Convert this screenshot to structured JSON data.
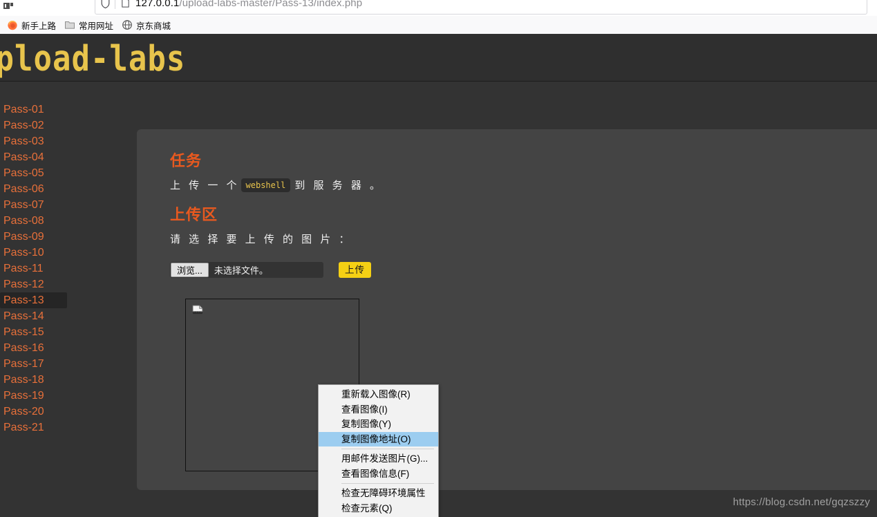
{
  "browser": {
    "url_host": "127.0.0.1",
    "url_path": "/upload-labs-master/Pass-13/index.php",
    "shield_icon": "shield-icon",
    "page_icon": "page-icon",
    "bookmarks": [
      {
        "label": "新手上路",
        "icon": "firefox-icon"
      },
      {
        "label": "常用网址",
        "icon": "folder-icon"
      },
      {
        "label": "京东商城",
        "icon": "globe-icon"
      }
    ]
  },
  "site": {
    "logo_text": "upload-labs",
    "logo_color": "#e8c44c"
  },
  "sidebar": {
    "items": [
      {
        "label": "Pass-01",
        "active": false
      },
      {
        "label": "Pass-02",
        "active": false
      },
      {
        "label": "Pass-03",
        "active": false
      },
      {
        "label": "Pass-04",
        "active": false
      },
      {
        "label": "Pass-05",
        "active": false
      },
      {
        "label": "Pass-06",
        "active": false
      },
      {
        "label": "Pass-07",
        "active": false
      },
      {
        "label": "Pass-08",
        "active": false
      },
      {
        "label": "Pass-09",
        "active": false
      },
      {
        "label": "Pass-10",
        "active": false
      },
      {
        "label": "Pass-11",
        "active": false
      },
      {
        "label": "Pass-12",
        "active": false
      },
      {
        "label": "Pass-13",
        "active": true
      },
      {
        "label": "Pass-14",
        "active": false
      },
      {
        "label": "Pass-15",
        "active": false
      },
      {
        "label": "Pass-16",
        "active": false
      },
      {
        "label": "Pass-17",
        "active": false
      },
      {
        "label": "Pass-18",
        "active": false
      },
      {
        "label": "Pass-19",
        "active": false
      },
      {
        "label": "Pass-20",
        "active": false
      },
      {
        "label": "Pass-21",
        "active": false
      }
    ],
    "link_color": "#e8703a",
    "active_bg": "#252525"
  },
  "main": {
    "task_heading": "任务",
    "task_text_before": "上 传 一 个",
    "task_code": "webshell",
    "task_text_after": "到 服 务 器 。",
    "upload_heading": "上传区",
    "upload_prompt": "请 选 择 要 上 传 的 图 片 ：",
    "browse_button": "浏览...",
    "file_status": "未选择文件。",
    "submit_button": "上传",
    "heading_color": "#e8591f",
    "submit_color": "#f5d014",
    "broken_image_icon": "broken-image-icon"
  },
  "context_menu": {
    "items": [
      {
        "label": "重新载入图像(R)",
        "accel": "R",
        "highlighted": false,
        "separator_after": false
      },
      {
        "label": "查看图像(I)",
        "accel": "I",
        "highlighted": false,
        "separator_after": false
      },
      {
        "label": "复制图像(Y)",
        "accel": "Y",
        "highlighted": false,
        "separator_after": false
      },
      {
        "label": "复制图像地址(O)",
        "accel": "O",
        "highlighted": true,
        "separator_after": true
      },
      {
        "label": "用邮件发送图片(G)...",
        "accel": "G",
        "highlighted": false,
        "separator_after": false
      },
      {
        "label": "查看图像信息(F)",
        "accel": "F",
        "highlighted": false,
        "separator_after": true
      },
      {
        "label": "检查无障碍环境属性",
        "accel": "",
        "highlighted": false,
        "separator_after": false
      },
      {
        "label": "检查元素(Q)",
        "accel": "Q",
        "highlighted": false,
        "separator_after": false
      }
    ],
    "highlight_color": "#9ccdf0"
  },
  "watermark": {
    "text": "https://blog.csdn.net/gqzszzy"
  }
}
